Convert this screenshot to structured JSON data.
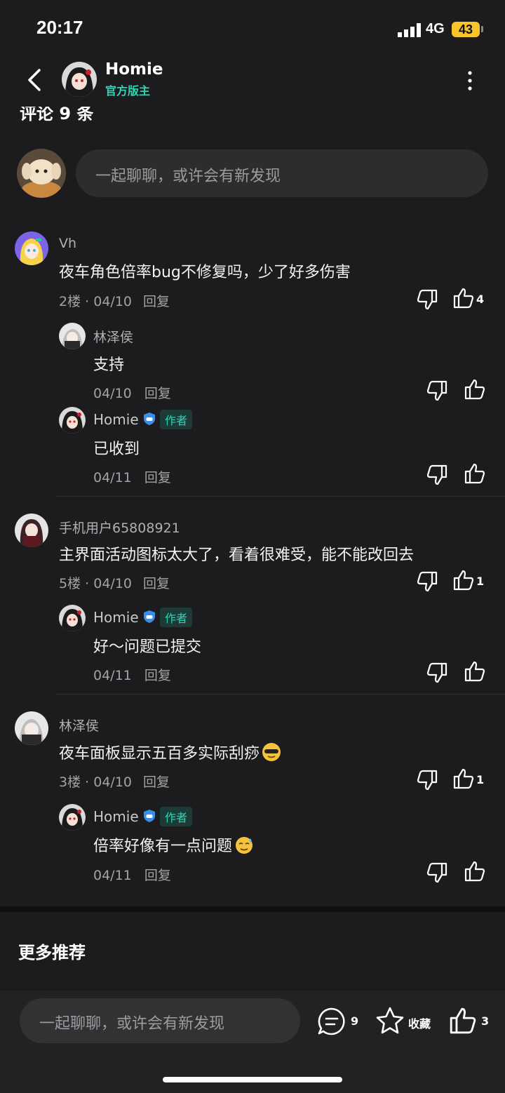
{
  "status_bar": {
    "time": "20:17",
    "network": "4G",
    "battery": "43"
  },
  "header": {
    "name": "Homie",
    "role": "官方版主"
  },
  "comments_section": {
    "title": "评论 9 条",
    "input_placeholder": "一起聊聊，或许会有新发现"
  },
  "comments": [
    {
      "user": "Vh",
      "text": "夜车角色倍率bug不修复吗，少了好多伤害",
      "floor": "2楼",
      "date": "04/10",
      "reply": "回复",
      "likes": "4",
      "replies": [
        {
          "user": "林泽侯",
          "text": "支持",
          "date": "04/10",
          "reply": "回复"
        },
        {
          "user": "Homie",
          "tag": "作者",
          "text": "已收到",
          "date": "04/11",
          "reply": "回复"
        }
      ]
    },
    {
      "user": "手机用户65808921",
      "text": "主界面活动图标太大了，看着很难受，能不能改回去",
      "floor": "5楼",
      "date": "04/10",
      "reply": "回复",
      "likes": "1",
      "replies": [
        {
          "user": "Homie",
          "tag": "作者",
          "text": "好～问题已提交",
          "date": "04/11",
          "reply": "回复"
        }
      ]
    },
    {
      "user": "林泽侯",
      "text": "夜车面板显示五百多实际刮痧",
      "floor": "3楼",
      "date": "04/10",
      "reply": "回复",
      "likes": "1",
      "replies": [
        {
          "user": "Homie",
          "tag": "作者",
          "text": "倍率好像有一点问题",
          "date": "04/11",
          "reply": "回复"
        }
      ]
    }
  ],
  "more_section": {
    "title": "更多推荐"
  },
  "bottom_bar": {
    "input_placeholder": "一起聊聊，或许会有新发现",
    "comment_count": "9",
    "favorite_label": "收藏",
    "like_count": "3"
  },
  "colors": {
    "accent": "#2fd3b6",
    "background": "#1c1c1e",
    "battery": "#f7c52b"
  },
  "icons": [
    "back-icon",
    "more-icon",
    "dislike-icon",
    "like-icon",
    "comment-icon",
    "star-icon",
    "shield-badge-icon"
  ]
}
